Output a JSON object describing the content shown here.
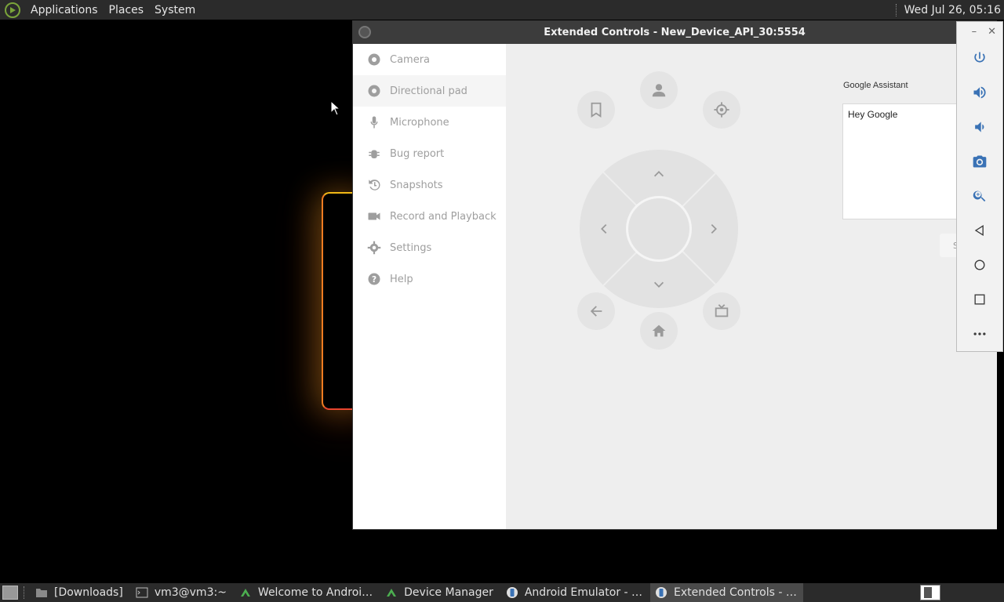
{
  "top_panel": {
    "menus": [
      "Applications",
      "Places",
      "System"
    ],
    "clock": "Wed Jul 26, 05:16"
  },
  "window": {
    "title": "Extended Controls - New_Device_API_30:5554",
    "nav": [
      {
        "label": "Camera",
        "icon": "camera-icon"
      },
      {
        "label": "Directional pad",
        "icon": "dpad-icon",
        "active": true
      },
      {
        "label": "Microphone",
        "icon": "microphone-icon"
      },
      {
        "label": "Bug report",
        "icon": "bug-icon"
      },
      {
        "label": "Snapshots",
        "icon": "history-icon"
      },
      {
        "label": "Record and Playback",
        "icon": "videocam-icon"
      },
      {
        "label": "Settings",
        "icon": "gear-icon"
      },
      {
        "label": "Help",
        "icon": "help-icon"
      }
    ],
    "assistant": {
      "label": "Google Assistant",
      "text": "Hey Google",
      "send_partial": "S"
    }
  },
  "emulator_toolbar": {
    "minimize": "–",
    "close": "✕",
    "buttons": [
      "power-icon",
      "volume-up-icon",
      "volume-down-icon",
      "screenshot-icon",
      "zoom-icon",
      "back-icon",
      "home-icon",
      "overview-icon",
      "more-icon"
    ]
  },
  "taskbar": {
    "items": [
      {
        "label": "[Downloads]",
        "icon": "folder-icon"
      },
      {
        "label": "vm3@vm3:~",
        "icon": "terminal-icon"
      },
      {
        "label": "Welcome to Androi…",
        "icon": "android-studio-icon"
      },
      {
        "label": "Device Manager",
        "icon": "android-studio-icon"
      },
      {
        "label": "Android Emulator - …",
        "icon": "emulator-icon"
      },
      {
        "label": "Extended Controls - …",
        "icon": "emulator-icon",
        "active": true
      }
    ]
  }
}
